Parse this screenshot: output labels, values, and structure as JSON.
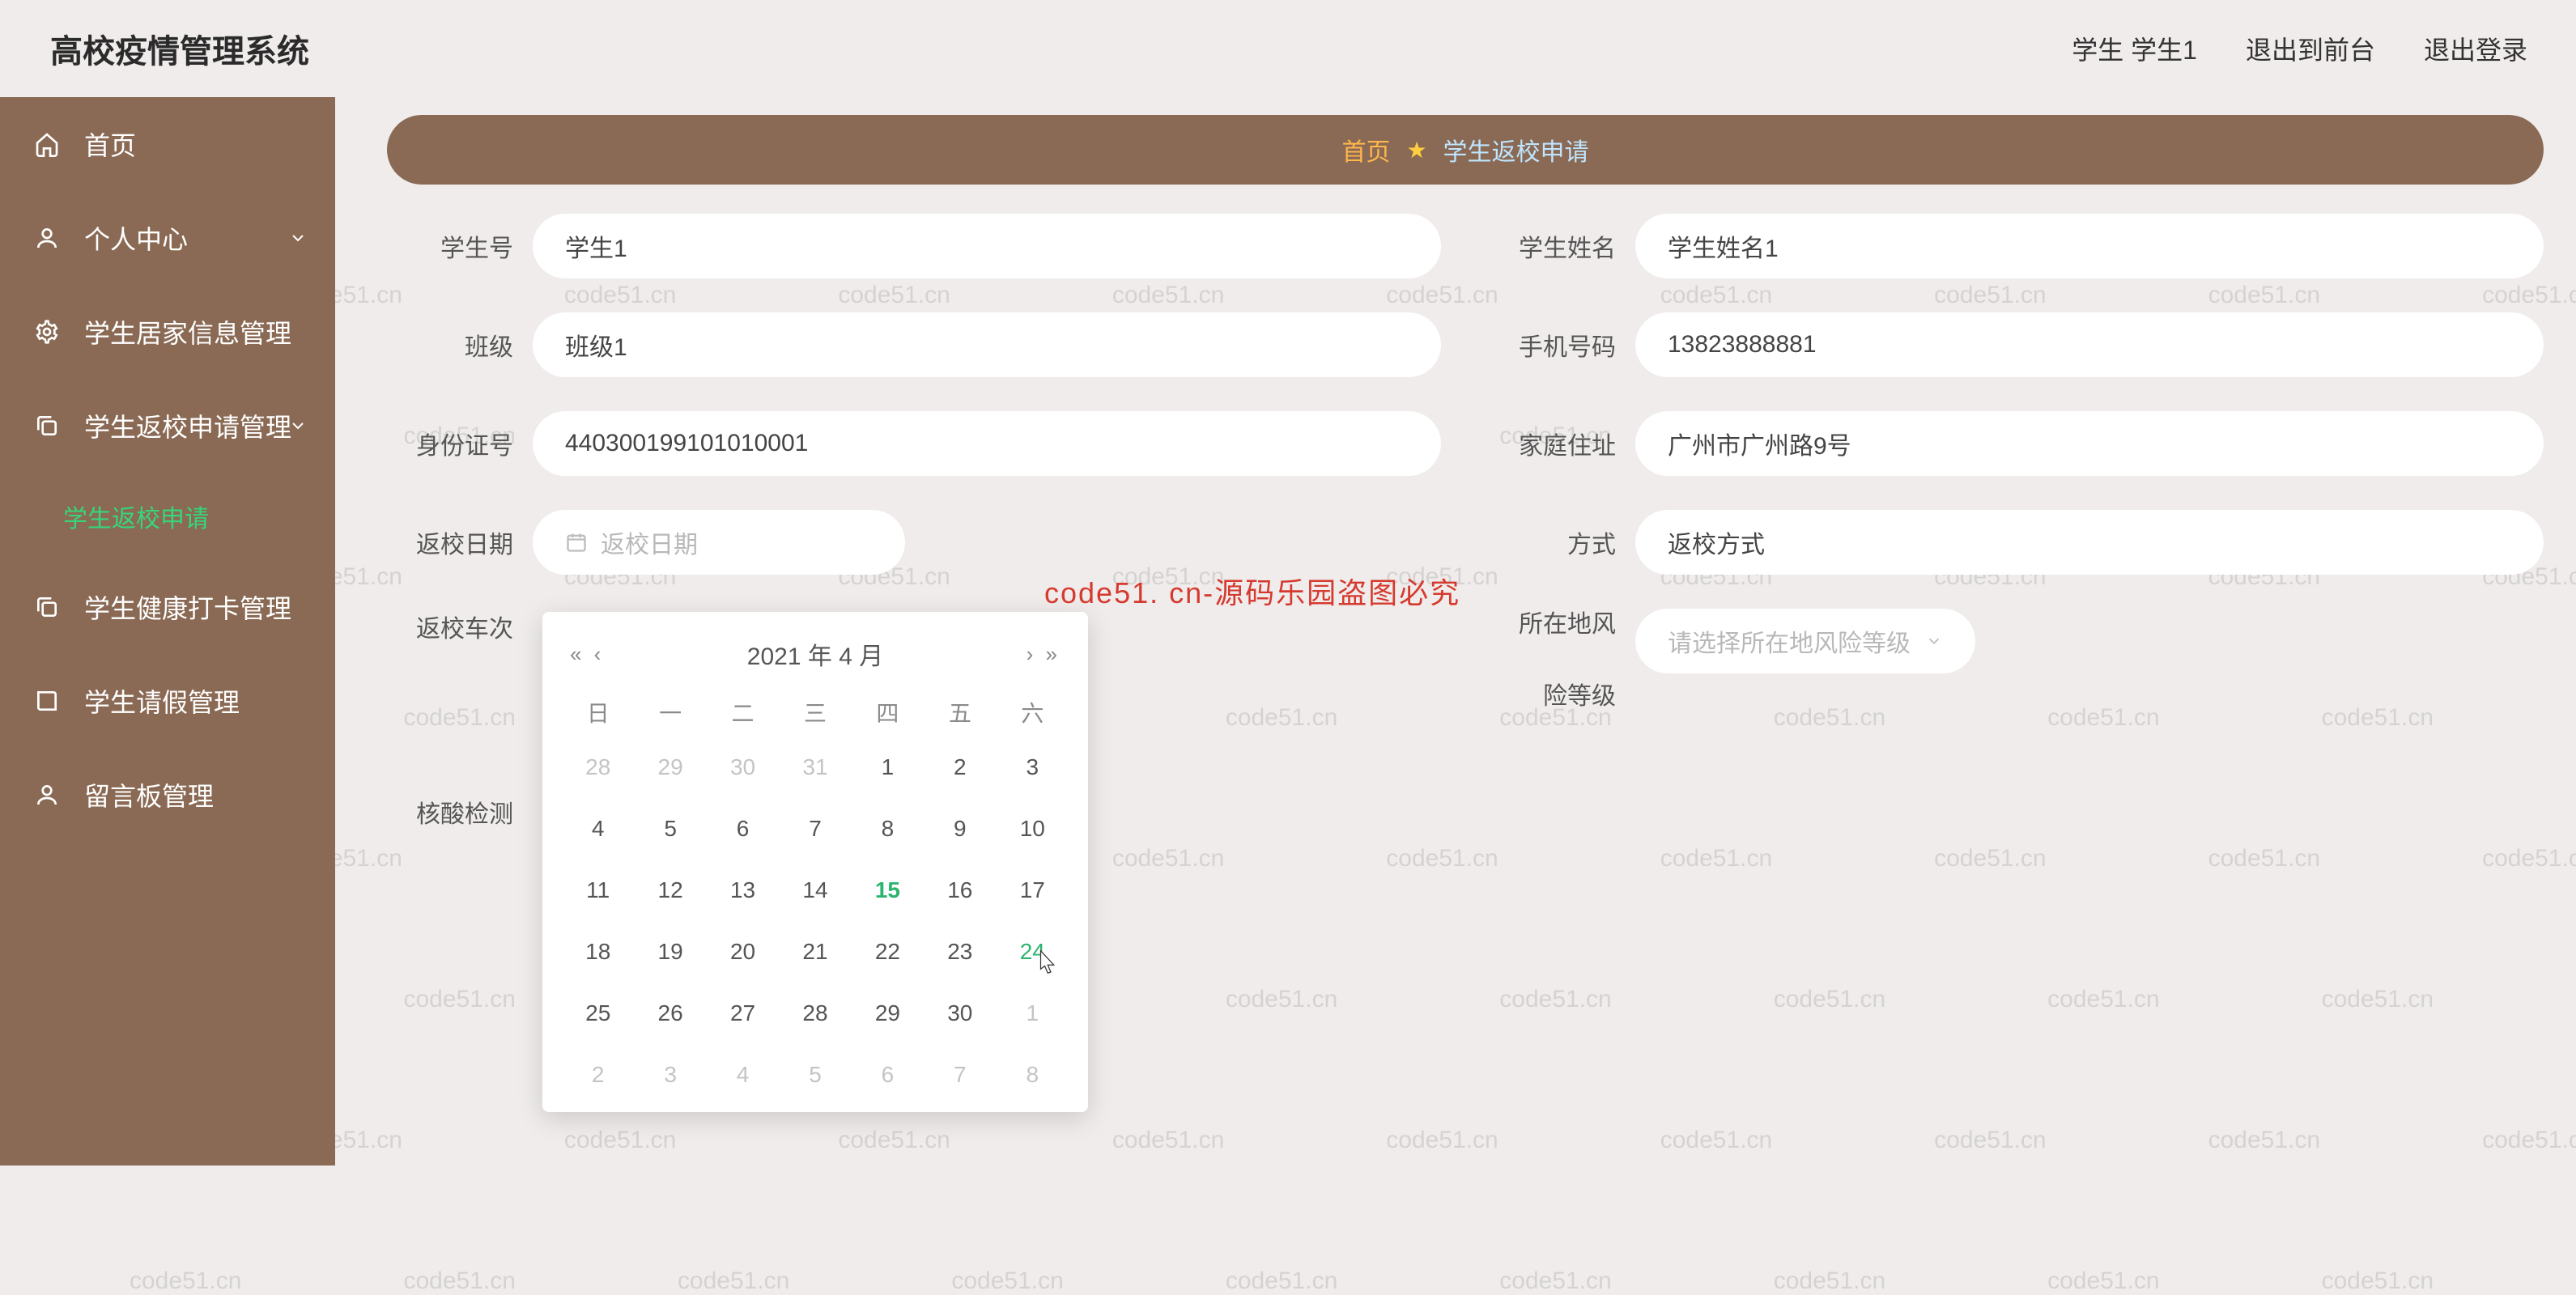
{
  "app_title": "高校疫情管理系统",
  "header": {
    "role": "学生",
    "username": "学生1",
    "logout_front": "退出到前台",
    "logout": "退出登录"
  },
  "watermark_text": "code51.cn",
  "sidebar": {
    "items": [
      {
        "icon": "home",
        "label": "首页"
      },
      {
        "icon": "user",
        "label": "个人中心",
        "expandable": true
      },
      {
        "icon": "gear",
        "label": "学生居家信息管理"
      },
      {
        "icon": "copy",
        "label": "学生返校申请管理",
        "expandable": true
      },
      {
        "icon": "copy",
        "label": "学生健康打卡管理"
      },
      {
        "icon": "book",
        "label": "学生请假管理"
      },
      {
        "icon": "user",
        "label": "留言板管理"
      }
    ],
    "sub_active": "学生返校申请"
  },
  "tabs": {
    "home": "首页",
    "current": "学生返校申请"
  },
  "form": {
    "student_id": {
      "label": "学生号",
      "value": "学生1"
    },
    "student_name": {
      "label": "学生姓名",
      "value": "学生姓名1"
    },
    "class": {
      "label": "班级",
      "value": "班级1"
    },
    "phone": {
      "label": "手机号码",
      "value": "13823888881"
    },
    "id_card": {
      "label": "身份证号",
      "value": "440300199101010001"
    },
    "home_addr": {
      "label": "家庭住址",
      "value": "广州市广州路9号"
    },
    "return_date": {
      "label": "返校日期",
      "placeholder": "返校日期"
    },
    "return_way": {
      "label": "方式",
      "value": "返校方式"
    },
    "return_train": {
      "label": "返校车次"
    },
    "risk_level": {
      "label_line1": "所在地风",
      "label_line2": "险等级",
      "placeholder": "请选择所在地风险等级"
    },
    "nucleic": {
      "label": "核酸检测"
    }
  },
  "datepicker": {
    "title": "2021 年 4 月",
    "weekdays": [
      "日",
      "一",
      "二",
      "三",
      "四",
      "五",
      "六"
    ],
    "weeks": [
      [
        {
          "d": "28",
          "o": true
        },
        {
          "d": "29",
          "o": true
        },
        {
          "d": "30",
          "o": true
        },
        {
          "d": "31",
          "o": true
        },
        {
          "d": "1"
        },
        {
          "d": "2"
        },
        {
          "d": "3"
        }
      ],
      [
        {
          "d": "4"
        },
        {
          "d": "5"
        },
        {
          "d": "6"
        },
        {
          "d": "7"
        },
        {
          "d": "8"
        },
        {
          "d": "9"
        },
        {
          "d": "10"
        }
      ],
      [
        {
          "d": "11"
        },
        {
          "d": "12"
        },
        {
          "d": "13"
        },
        {
          "d": "14"
        },
        {
          "d": "15",
          "today": true
        },
        {
          "d": "16"
        },
        {
          "d": "17"
        }
      ],
      [
        {
          "d": "18"
        },
        {
          "d": "19"
        },
        {
          "d": "20"
        },
        {
          "d": "21"
        },
        {
          "d": "22"
        },
        {
          "d": "23"
        },
        {
          "d": "24",
          "hover": true
        }
      ],
      [
        {
          "d": "25"
        },
        {
          "d": "26"
        },
        {
          "d": "27"
        },
        {
          "d": "28"
        },
        {
          "d": "29"
        },
        {
          "d": "30"
        },
        {
          "d": "1",
          "o": true
        }
      ],
      [
        {
          "d": "2",
          "o": true
        },
        {
          "d": "3",
          "o": true
        },
        {
          "d": "4",
          "o": true
        },
        {
          "d": "5",
          "o": true
        },
        {
          "d": "6",
          "o": true
        },
        {
          "d": "7",
          "o": true
        },
        {
          "d": "8",
          "o": true
        }
      ]
    ]
  },
  "overlay_text": "code51. cn-源码乐园盗图必究"
}
